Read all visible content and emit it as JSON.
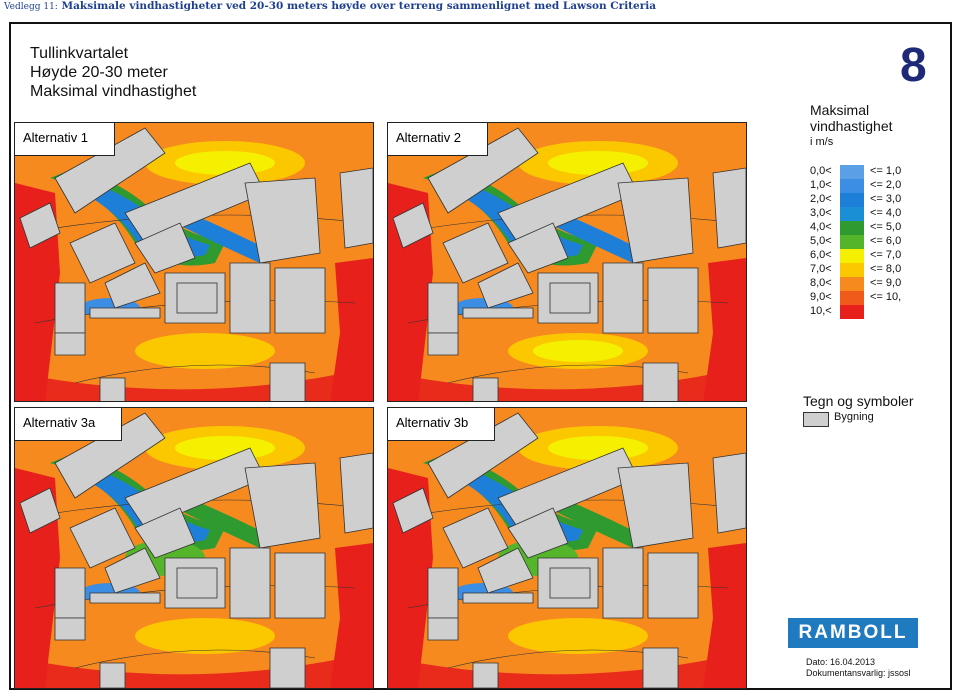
{
  "caption": {
    "prefix": "Vedlegg 11:",
    "text": "Maksimale vindhastigheter ved 20-30 meters høyde over terreng sammenlignet med Lawson Criteria"
  },
  "title": {
    "line1": "Tullinkvartalet",
    "line2": "Høyde 20-30 meter",
    "line3": "Maksimal vindhastighet"
  },
  "sheet_number": "8",
  "maps": [
    {
      "label": "Alternativ 1"
    },
    {
      "label": "Alternativ 2"
    },
    {
      "label": "Alternativ 3a"
    },
    {
      "label": "Alternativ 3b"
    }
  ],
  "legend": {
    "title_line1": "Maksimal",
    "title_line2": "vindhastighet",
    "unit": "i m/s",
    "rows": [
      {
        "lo": "0,0<",
        "hi": "<= 1,0",
        "color": "#5aa0e6"
      },
      {
        "lo": "1,0<",
        "hi": "<= 2,0",
        "color": "#3b8ee3"
      },
      {
        "lo": "2,0<",
        "hi": "<= 3,0",
        "color": "#1e7fd8"
      },
      {
        "lo": "3,0<",
        "hi": "<= 4,0",
        "color": "#1a8fd6"
      },
      {
        "lo": "4,0<",
        "hi": "<= 5,0",
        "color": "#2f9a2f"
      },
      {
        "lo": "5,0<",
        "hi": "<= 6,0",
        "color": "#54b52a"
      },
      {
        "lo": "6,0<",
        "hi": "<= 7,0",
        "color": "#f4f000"
      },
      {
        "lo": "7,0<",
        "hi": "<= 8,0",
        "color": "#fbc800"
      },
      {
        "lo": "8,0<",
        "hi": "<= 9,0",
        "color": "#f68a1f"
      },
      {
        "lo": "9,0<",
        "hi": "<= 10,",
        "color": "#f05a1a"
      },
      {
        "lo": "10,<",
        "hi": "",
        "color": "#e8201c"
      }
    ]
  },
  "symbols": {
    "title": "Tegn og symboler",
    "building_label": "Bygning"
  },
  "logo": "RAMBOLL",
  "footer": {
    "date": "Dato: 16.04.2013",
    "owner": "Dokumentansvarlig: jssosl"
  }
}
